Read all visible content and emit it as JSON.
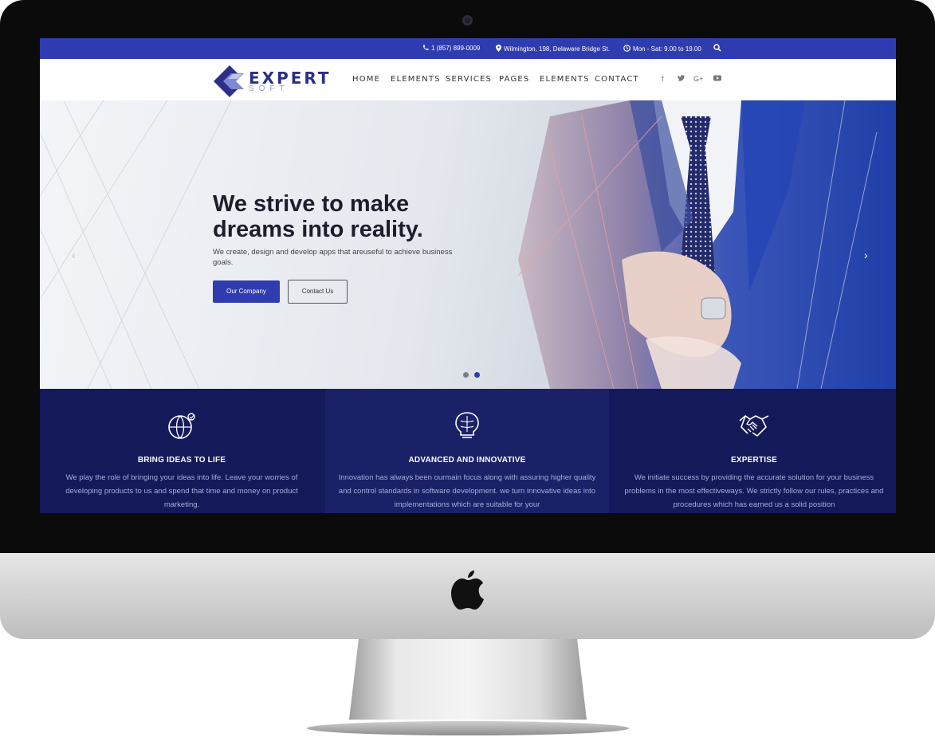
{
  "topbar": {
    "phone": "1 (857) 899-0009",
    "address": "Wilmington, 198, Delaware Bridge St.",
    "hours": "Mon - Sat: 9.00 to 19.00"
  },
  "logo": {
    "name": "EXPERT",
    "sub": "SOFT"
  },
  "nav": [
    "HOME",
    "ELEMENTS",
    "SERVICES",
    "PAGES",
    "ELEMENTS",
    "CONTACT"
  ],
  "social": [
    "f",
    "t",
    "G+",
    "youtube"
  ],
  "hero": {
    "title": "We strive to make dreams into reality.",
    "text": "We create, design and develop apps that areuseful to achieve business goals.",
    "primary_button": "Our Company",
    "secondary_button": "Contact Us",
    "slide_count": 2,
    "active_slide": 2
  },
  "features": [
    {
      "icon": "globe-icon",
      "title": "BRING IDEAS TO LIFE",
      "text": "We play the role of bringing your ideas into life. Leave your worries of developing products to us and spend that time and money on product marketing."
    },
    {
      "icon": "brain-bulb-icon",
      "title": "ADVANCED AND INNOVATIVE",
      "text": "Innovation has always been ourmain focus along with assuring higher quality and control standards in software development. we turn innovative ideas into implementations which are suitable for your"
    },
    {
      "icon": "handshake-icon",
      "title": "EXPERTISE",
      "text": "We initiate success by providing the accurate solution for your business problems in the most effectiveways. We strictly follow our rules, practices and procedures which has earned us a solid position"
    }
  ],
  "colors": {
    "brand": "#2f3caf",
    "features_bg": "#14195a",
    "feature_text": "#a7acd6"
  }
}
